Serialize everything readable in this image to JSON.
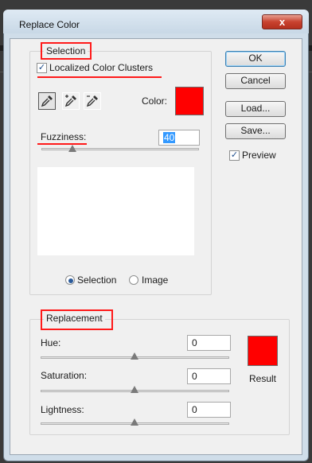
{
  "window": {
    "title": "Replace Color",
    "close_glyph": "x"
  },
  "selection": {
    "group_label": "Selection",
    "localized_checkbox": {
      "label": "Localized Color Clusters",
      "checked": true
    },
    "tools": [
      "eyedropper-icon",
      "eyedropper-plus-icon",
      "eyedropper-minus-icon"
    ],
    "color_label": "Color:",
    "color_value": "#ff0000",
    "fuzziness": {
      "label": "Fuzziness:",
      "value": "40",
      "slider_fraction": 0.2
    },
    "view_options": [
      {
        "label": "Selection",
        "selected": true
      },
      {
        "label": "Image",
        "selected": false
      }
    ]
  },
  "replacement": {
    "group_label": "Replacement",
    "hue": {
      "label": "Hue:",
      "value": "0"
    },
    "saturation": {
      "label": "Saturation:",
      "value": "0"
    },
    "lightness": {
      "label": "Lightness:",
      "value": "0"
    },
    "result_label": "Result",
    "result_color": "#ff0000"
  },
  "buttons": {
    "ok": "OK",
    "cancel": "Cancel",
    "load": "Load...",
    "save": "Save..."
  },
  "preview": {
    "label": "Preview",
    "checked": true
  },
  "check_glyph": "✓"
}
